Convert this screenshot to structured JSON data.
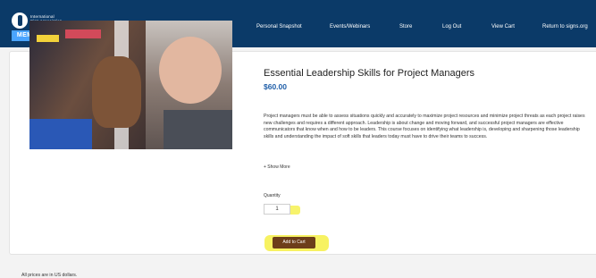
{
  "header": {
    "logo_lines": [
      "International",
      "Sign Association"
    ],
    "member_hub": "MEMBER HUB",
    "nav": [
      "Personal Snapshot",
      "Events/Webinars",
      "Store",
      "Log Out",
      "View Cart",
      "Return to signs.org"
    ]
  },
  "product": {
    "title": "Essential Leadership Skills for Project Managers",
    "price": "$60.00",
    "description": "Project managers must be able to assess situations quickly and accurately to maximize project resources and minimize project threats as each project raises new challenges and requires a different approach. Leadership is about change and moving forward, and successful project managers are effective communicators that know when and how to be leaders. This course focuses on identifying what leadership is, developing and sharpening those leadership skills and understanding the impact of soft skills that leaders today must have to drive their teams to success.",
    "show_more": "+ Show More",
    "quantity_label": "Quantity",
    "quantity_value": "1",
    "add_to_cart": "Add to Cart"
  },
  "footer": {
    "note": "All prices are in US dollars."
  },
  "colors": {
    "header_bg": "#0b3a68",
    "price": "#1f5ea8",
    "button_bg": "#6d3e1a",
    "highlight": "#f4ee2d"
  }
}
